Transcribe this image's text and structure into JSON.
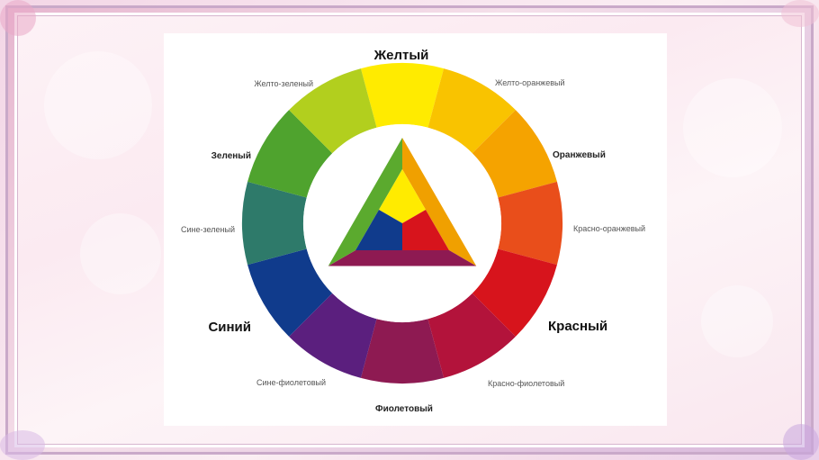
{
  "color_wheel": {
    "labels": {
      "yellow": "Желтый",
      "yellow_orange": "Желто-оранжевый",
      "orange": "Оранжевый",
      "red_orange": "Красно-оранжевый",
      "red": "Красный",
      "red_violet": "Красно-фиолетовый",
      "violet": "Фиолетовый",
      "blue_violet": "Сине-фиолетовый",
      "blue": "Синий",
      "blue_green": "Сине-зеленый",
      "green": "Зеленый",
      "yellow_green": "Желто-зеленый"
    },
    "ring_colors": [
      "#FFEB00",
      "#F9C300",
      "#F5A300",
      "#E94E1B",
      "#D7141C",
      "#B3133B",
      "#8E1A52",
      "#5B1F7E",
      "#103B8C",
      "#2E7A6A",
      "#4FA32E",
      "#B2CF1E"
    ],
    "center": {
      "yellow": "#FFEB00",
      "red": "#D7141C",
      "blue": "#103B8C",
      "orange": "#F0A000",
      "violet": "#8E1A52",
      "green": "#5BAA2E"
    }
  }
}
